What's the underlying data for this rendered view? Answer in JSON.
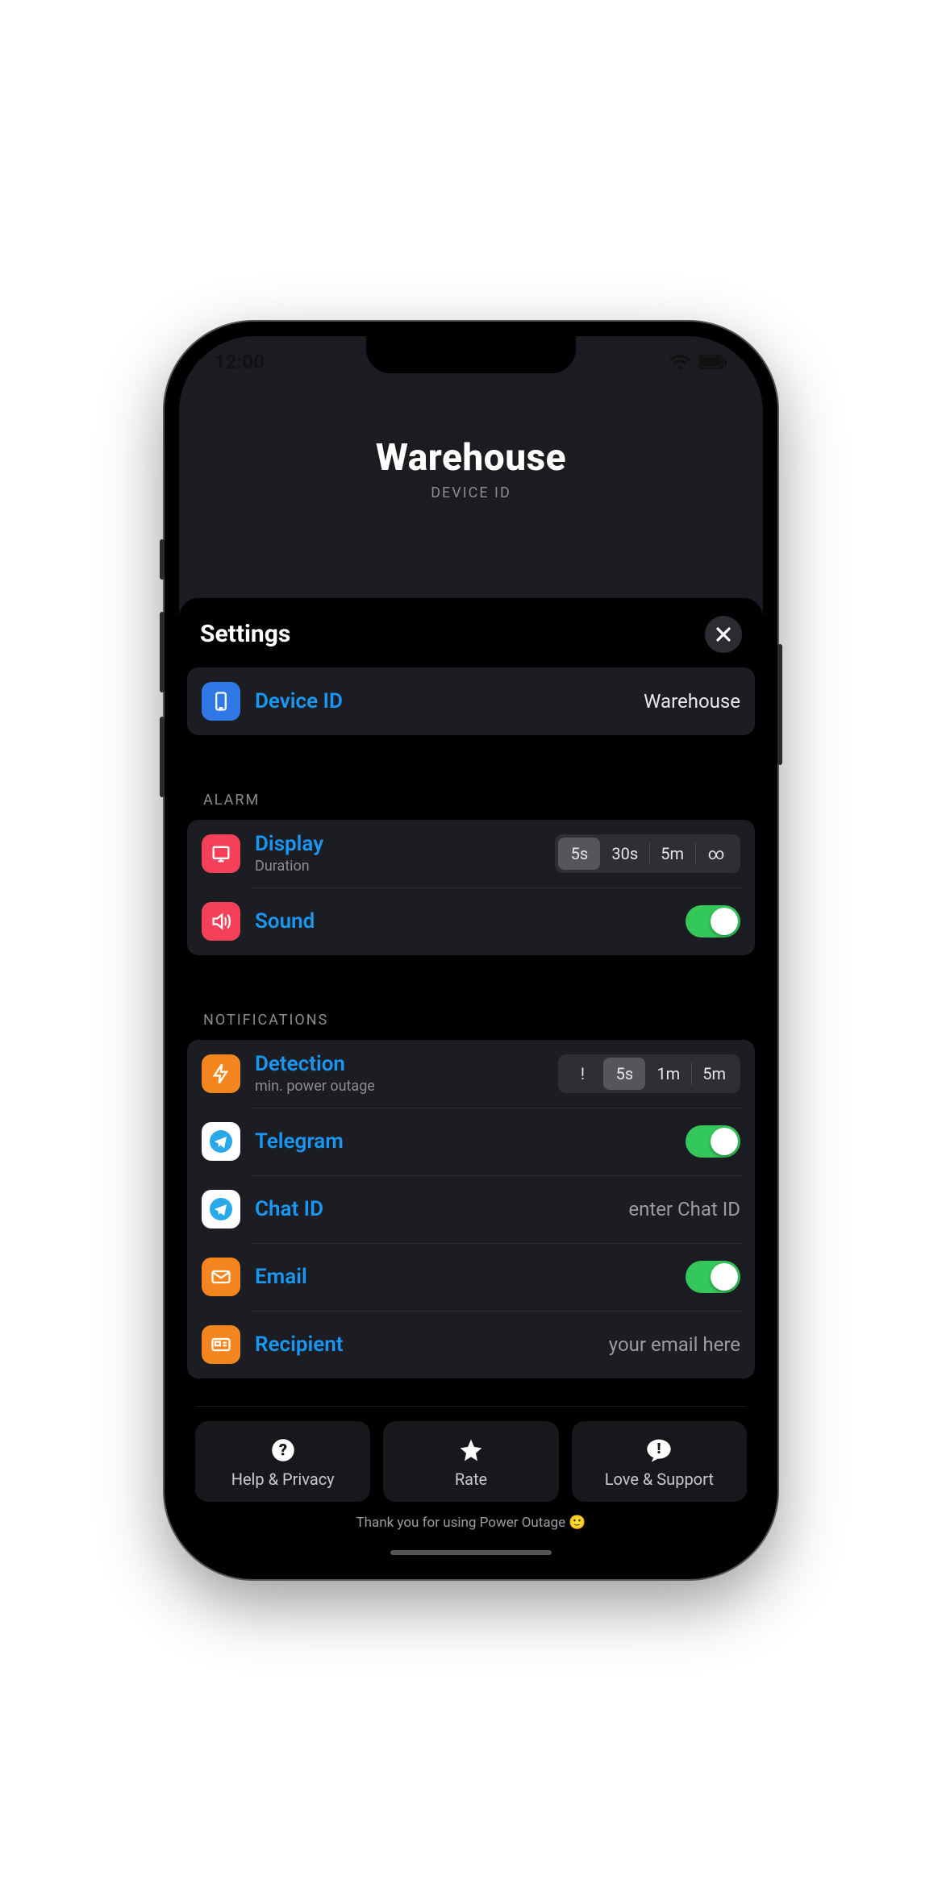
{
  "status": {
    "time": "12:00"
  },
  "header": {
    "title": "Warehouse",
    "subtitle": "DEVICE ID"
  },
  "sheet": {
    "title": "Settings",
    "device": {
      "label": "Device ID",
      "value": "Warehouse"
    },
    "alarm": {
      "header": "ALARM",
      "display": {
        "label": "Display",
        "sub": "Duration",
        "options": [
          "5s",
          "30s",
          "5m",
          "∞"
        ],
        "selected": 0
      },
      "sound": {
        "label": "Sound",
        "on": true
      }
    },
    "notifications": {
      "header": "NOTIFICATIONS",
      "detection": {
        "label": "Detection",
        "sub": "min. power outage",
        "options": [
          "!",
          "5s",
          "1m",
          "5m"
        ],
        "selected": 1
      },
      "telegram": {
        "label": "Telegram",
        "on": true
      },
      "chat": {
        "label": "Chat ID",
        "placeholder": "enter Chat ID"
      },
      "email": {
        "label": "Email",
        "on": true
      },
      "recipient": {
        "label": "Recipient",
        "placeholder": "your email here"
      }
    },
    "footer": {
      "help": "Help & Privacy",
      "rate": "Rate",
      "love": "Love & Support",
      "thanks": "Thank you for using Power Outage 🙂"
    }
  }
}
